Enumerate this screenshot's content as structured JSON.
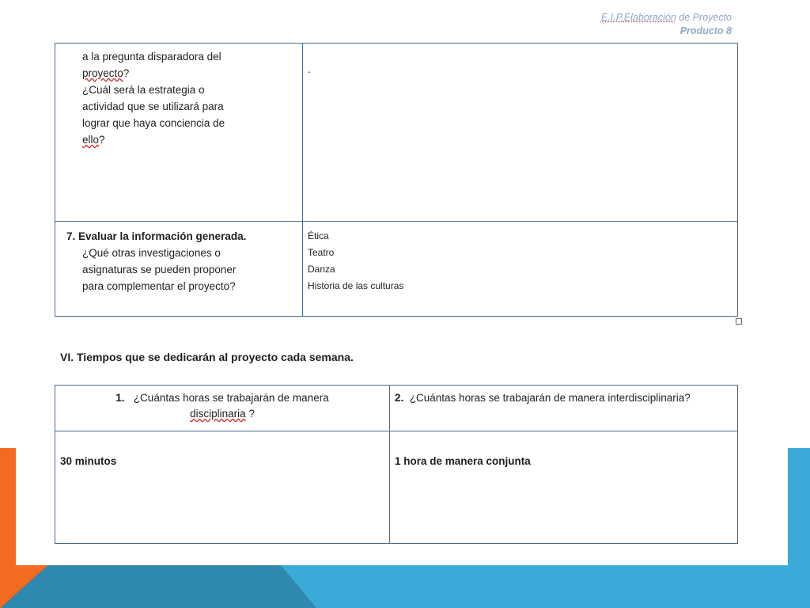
{
  "header": {
    "line1_part1": "E.I.P.",
    "line1_part2": "Elaboración",
    "line1_part3": " de Proyecto",
    "line2": "Producto 8"
  },
  "table_top": {
    "row1": {
      "left_lines": [
        "a  la pregunta disparadora del",
        "proyecto",
        "?",
        "¿Cuál será la   estrategia o",
        "actividad  que se utilizará para",
        "lograr que haya  conciencia de",
        "ello",
        "?"
      ],
      "right": "."
    },
    "row2": {
      "title": "7. Evaluar la información generada.",
      "question_lines": [
        "¿Qué otras investigaciones o",
        "asignaturas se pueden  proponer",
        "para complementar el proyecto?"
      ],
      "subjects": [
        "Ética",
        "Teatro",
        "Danza",
        "Historia de las culturas"
      ]
    }
  },
  "section_title": "VI. Tiempos que se dedicarán al proyecto cada semana.",
  "table_bottom": {
    "q1_num": "1.",
    "q1_text": "¿Cuántas horas se trabajarán de manera",
    "q1_word": "disciplinaria",
    "q1_end": " ?",
    "q2_num": "2.",
    "q2_text": "¿Cuántas horas se trabajarán de manera interdisciplinaria?",
    "a1": "30 minutos",
    "a2": "1 hora de manera conjunta"
  }
}
